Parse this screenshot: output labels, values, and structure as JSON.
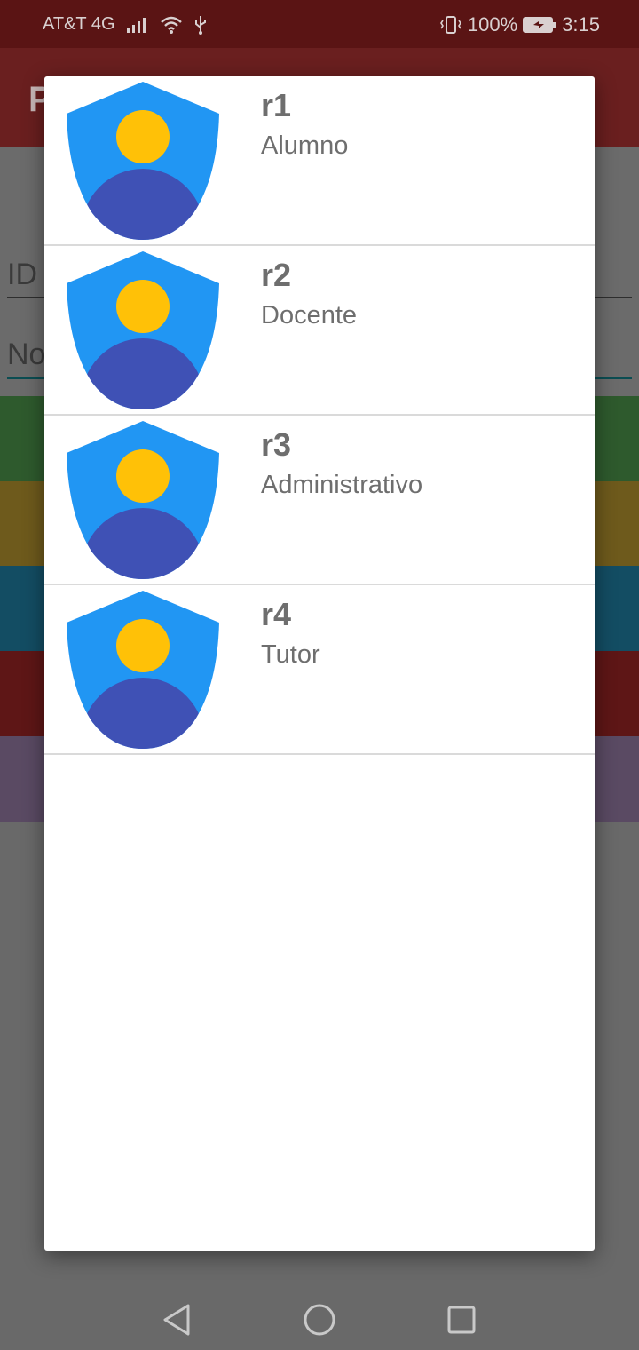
{
  "status_bar": {
    "carrier": "AT&T 4G",
    "battery": "100%",
    "time": "3:15",
    "icons": [
      "signal-icon",
      "wifi-icon",
      "usb-icon",
      "vibrate-icon",
      "battery-icon"
    ]
  },
  "background": {
    "app_title": "P",
    "field_id_placeholder": "ID",
    "field_name_placeholder": "No"
  },
  "roles": [
    {
      "code": "r1",
      "name": "Alumno"
    },
    {
      "code": "r2",
      "name": "Docente"
    },
    {
      "code": "r3",
      "name": "Administrativo"
    },
    {
      "code": "r4",
      "name": "Tutor"
    }
  ],
  "colors": {
    "shield": "#2196F3",
    "head": "#FFC107",
    "body": "#3F51B5",
    "text": "#6e6e6e"
  },
  "nav_bar": {
    "icons": [
      "back-icon",
      "home-icon",
      "recents-icon"
    ]
  }
}
